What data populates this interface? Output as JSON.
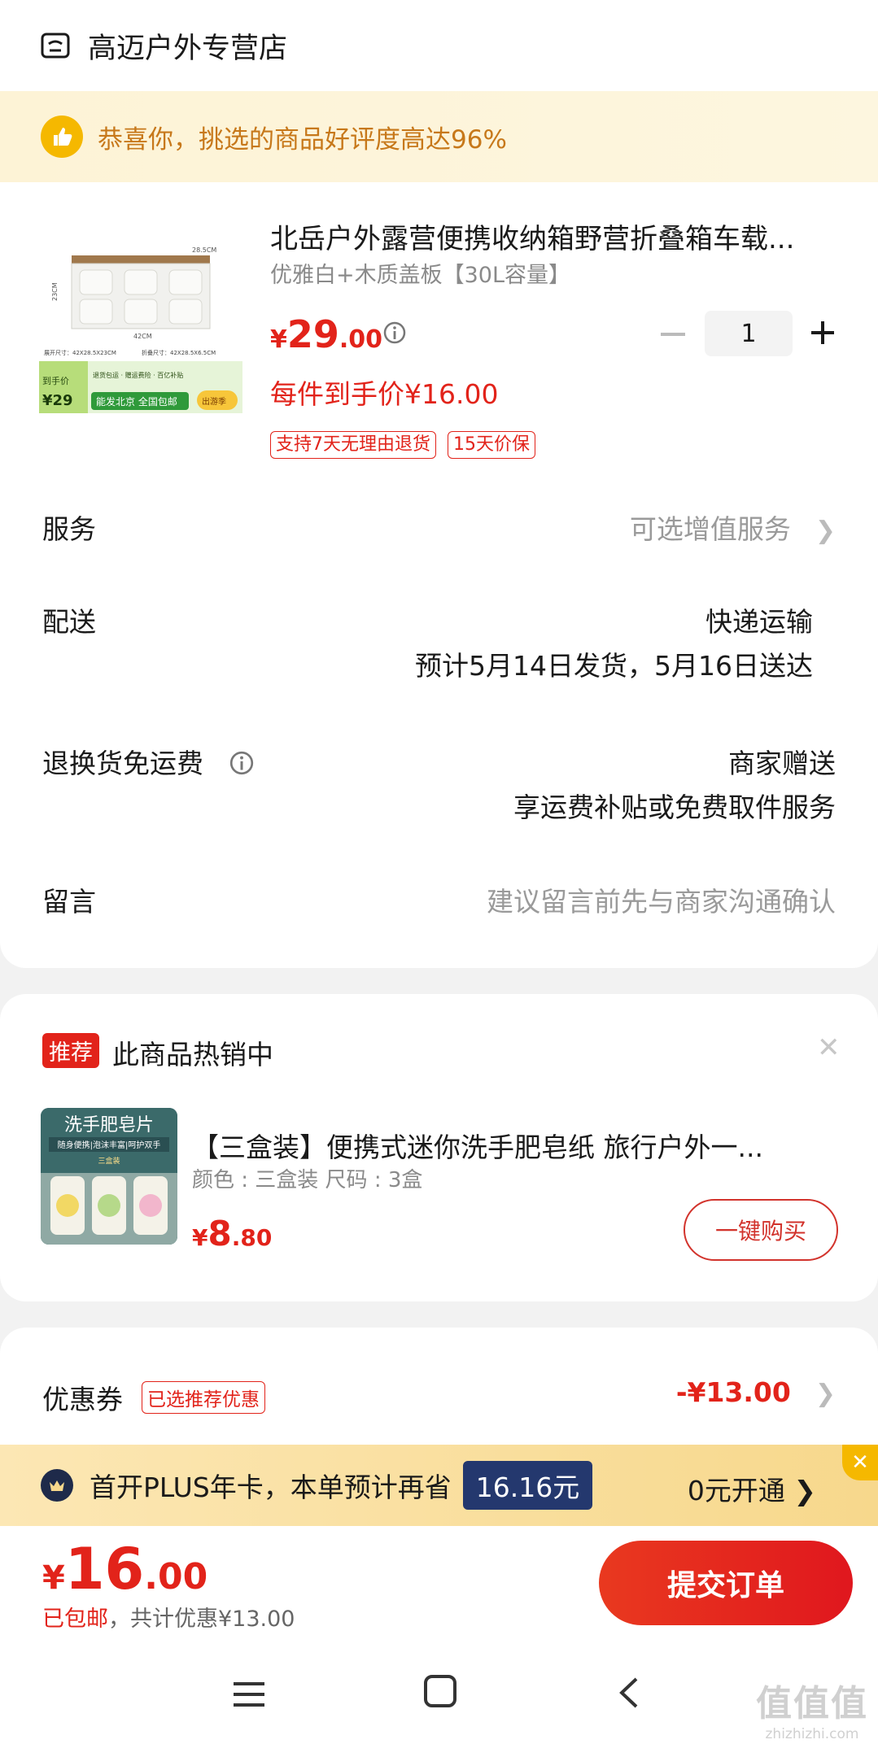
{
  "store": {
    "name": "高迈户外专营店"
  },
  "praise": {
    "text": "恭喜你，挑选的商品好评度高达96%"
  },
  "product": {
    "title": "北岳户外露营便携收纳箱野营折叠箱车载...",
    "spec": "优雅白+木质盖板【30L容量】",
    "price": {
      "yen": "¥",
      "int": "29",
      "dec": ".00"
    },
    "quantity": "1",
    "final_price": "每件到手价¥16.00",
    "tags": [
      "支持7天无理由退货",
      "15天价保"
    ],
    "image": {
      "dims_top": "28.5CM",
      "dims_side": "23CM",
      "dims_bottom": "42CM",
      "size_open": "展开尺寸：42X28.5X23CM",
      "size_fold": "折叠尺寸：42X28.5X6.5CM",
      "promo_price": "¥29",
      "promo_label": "到手价",
      "promo_text": "能发北京 全国包邮",
      "promo_badge": "出游季",
      "promo_info": "退货包运 · 赠运费险 · 百亿补贴"
    }
  },
  "rows": {
    "service": {
      "label": "服务",
      "value": "可选增值服务"
    },
    "delivery": {
      "label": "配送",
      "line1": "快递运输",
      "line2": "预计5月14日发货，5月16日送达"
    },
    "return": {
      "label": "退换货免运费",
      "line1": "商家赠送",
      "line2": "享运费补贴或免费取件服务"
    },
    "message": {
      "label": "留言",
      "placeholder": "建议留言前先与商家沟通确认"
    }
  },
  "recommend": {
    "badge": "推荐",
    "title": "此商品热销中",
    "name": "【三盒装】便携式迷你洗手肥皂纸 旅行户外一...",
    "spec": "颜色 : 三盒装   尺码 : 3盒",
    "price": {
      "yen": "¥",
      "int": "8",
      "dec": ".80"
    },
    "buy_label": "一键购买",
    "image": {
      "title": "洗手肥皂片",
      "subtitle": "随身便携|泡沫丰富|呵护双手",
      "note": "三盒装"
    }
  },
  "coupon": {
    "label": "优惠券",
    "tag": "已选推荐优惠",
    "value": "-¥13.00"
  },
  "plus": {
    "text": "首开PLUS年卡，本单预计再省",
    "amount": "16.16元",
    "open": "0元开通 ❯"
  },
  "submit": {
    "total": {
      "yen": "¥",
      "int": "16",
      "dec": ".00"
    },
    "note_prefix": "已包邮",
    "note_suffix": "，共计优惠¥13.00",
    "button": "提交订单"
  },
  "watermark": {
    "big": "值值值",
    "small": "zhizhizhi.com"
  },
  "colors": {
    "accent_red": "#e2231a",
    "plus_blue": "#24386e",
    "praise_orange": "#c7781a"
  }
}
